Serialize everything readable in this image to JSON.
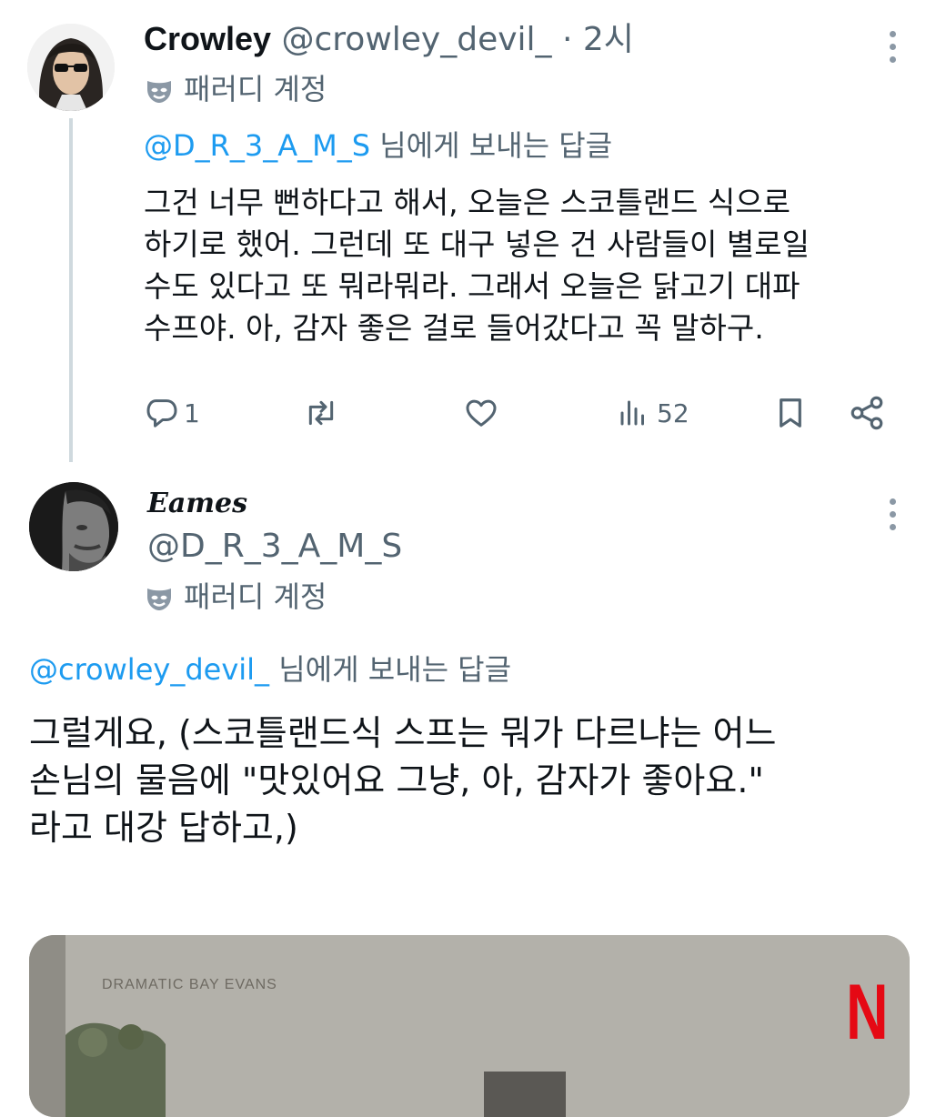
{
  "tweet1": {
    "display_name": "Crowley",
    "handle": "@crowley_devil_",
    "separator": " · ",
    "time": "2시",
    "badge_label": "패러디 계정",
    "reply_to_handle": "@D_R_3_A_M_S",
    "reply_to_suffix": " 님에게 보내는 답글",
    "text": "그건 너무 뻔하다고 해서, 오늘은 스코틀랜드 식으로\n하기로 했어. 그런데 또 대구 넣은 건 사람들이 별로일\n수도 있다고 또 뭐라뭐라. 그래서 오늘은 닭고기 대파\n수프야. 아, 감자 좋은 걸로 들어갔다고 꼭 말하구.",
    "replies": "1",
    "views": "52"
  },
  "tweet2": {
    "display_name": "Eames",
    "handle": "@D_R_3_A_M_S",
    "badge_label": "패러디 계정",
    "reply_to_handle": "@crowley_devil_",
    "reply_to_suffix": " 님에게 보내는 답글",
    "text": "그럴게요, (스코틀랜드식 스프는 뭐가 다르냐는 어느\n손님의 물음에 \"맛있어요 그냥, 아, 감자가 좋아요.\"\n라고 대강 답하고,)"
  },
  "media": {
    "caption": "DRAMATIC BAY EVANS",
    "brand_letter": "N"
  },
  "colors": {
    "text": "#0f1419",
    "secondary": "#536471",
    "accent": "#1d9bf0",
    "brand": "#e50914"
  },
  "icons": [
    "mask-icon",
    "reply-icon",
    "retweet-icon",
    "like-icon",
    "views-icon",
    "bookmark-icon",
    "share-icon",
    "more-icon"
  ]
}
